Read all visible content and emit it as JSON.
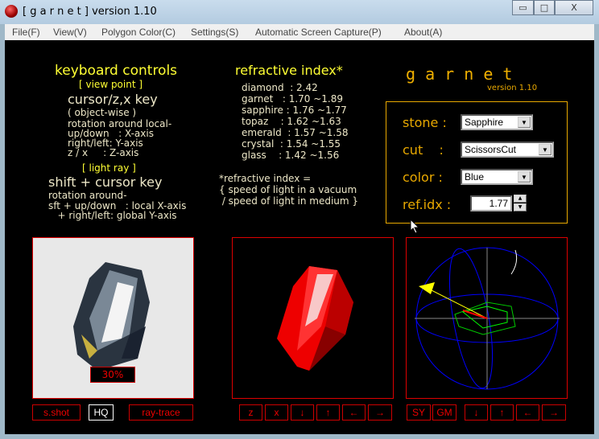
{
  "window": {
    "title": "[ g a r n e t ] version 1.10",
    "minimize": "▭",
    "maximize": "□",
    "close": "X"
  },
  "menu": [
    "File(F)",
    "View(V)",
    "Polygon Color(C)",
    "Settings(S)",
    "Automatic Screen Capture(P)",
    "About(A)"
  ],
  "keyboard": {
    "title": "keyboard controls",
    "view_point": "[ view point ]",
    "cursor_key": "cursor/z,x key",
    "object_wise": "( object-wise )",
    "rotation_local": "rotation around local-",
    "up_down": "up/down   : X-axis",
    "right_left": "right/left: Y-axis",
    "zx": "z / x     : Z-axis",
    "light_ray": "[ light ray ]",
    "shift_cursor": "shift + cursor key",
    "rotation_around": "rotation around-",
    "sft_up_down": "sft + up/down   : local X-axis",
    "sft_right_left": "   + right/left: global Y-axis"
  },
  "refractive": {
    "title": "refractive index*",
    "rows": [
      "diamond  : 2.42",
      "garnet   : 1.70 ~1.89",
      "sapphire : 1.76 ~1.77",
      "topaz    : 1.62 ~1.63",
      "emerald  : 1.57 ~1.58",
      "crystal  : 1.54 ~1.55",
      "glass    : 1.42 ~1.56"
    ],
    "note": [
      "*refractive index =",
      "{ speed of light in a vacuum",
      " / speed of light in medium }"
    ]
  },
  "brand": {
    "name": "g a r n e t",
    "version": "version 1.10"
  },
  "settings": {
    "stone_label": "stone :",
    "stone": "Sapphire",
    "cut_label": "cut    :",
    "cut": "ScissorsCut",
    "color_label": "color :",
    "color": "Blue",
    "refidx_label": "ref.idx :",
    "refidx": "1.77"
  },
  "render": {
    "progress": "30%"
  },
  "buttons": {
    "sshot": "s.shot",
    "hq": "HQ",
    "raytrace": "ray-trace",
    "p2": [
      "z",
      "x",
      "↓",
      "↑",
      "←",
      "→"
    ],
    "sy": "SY",
    "gm": "GM",
    "p3": [
      "↓",
      "↑",
      "←",
      "→"
    ]
  }
}
